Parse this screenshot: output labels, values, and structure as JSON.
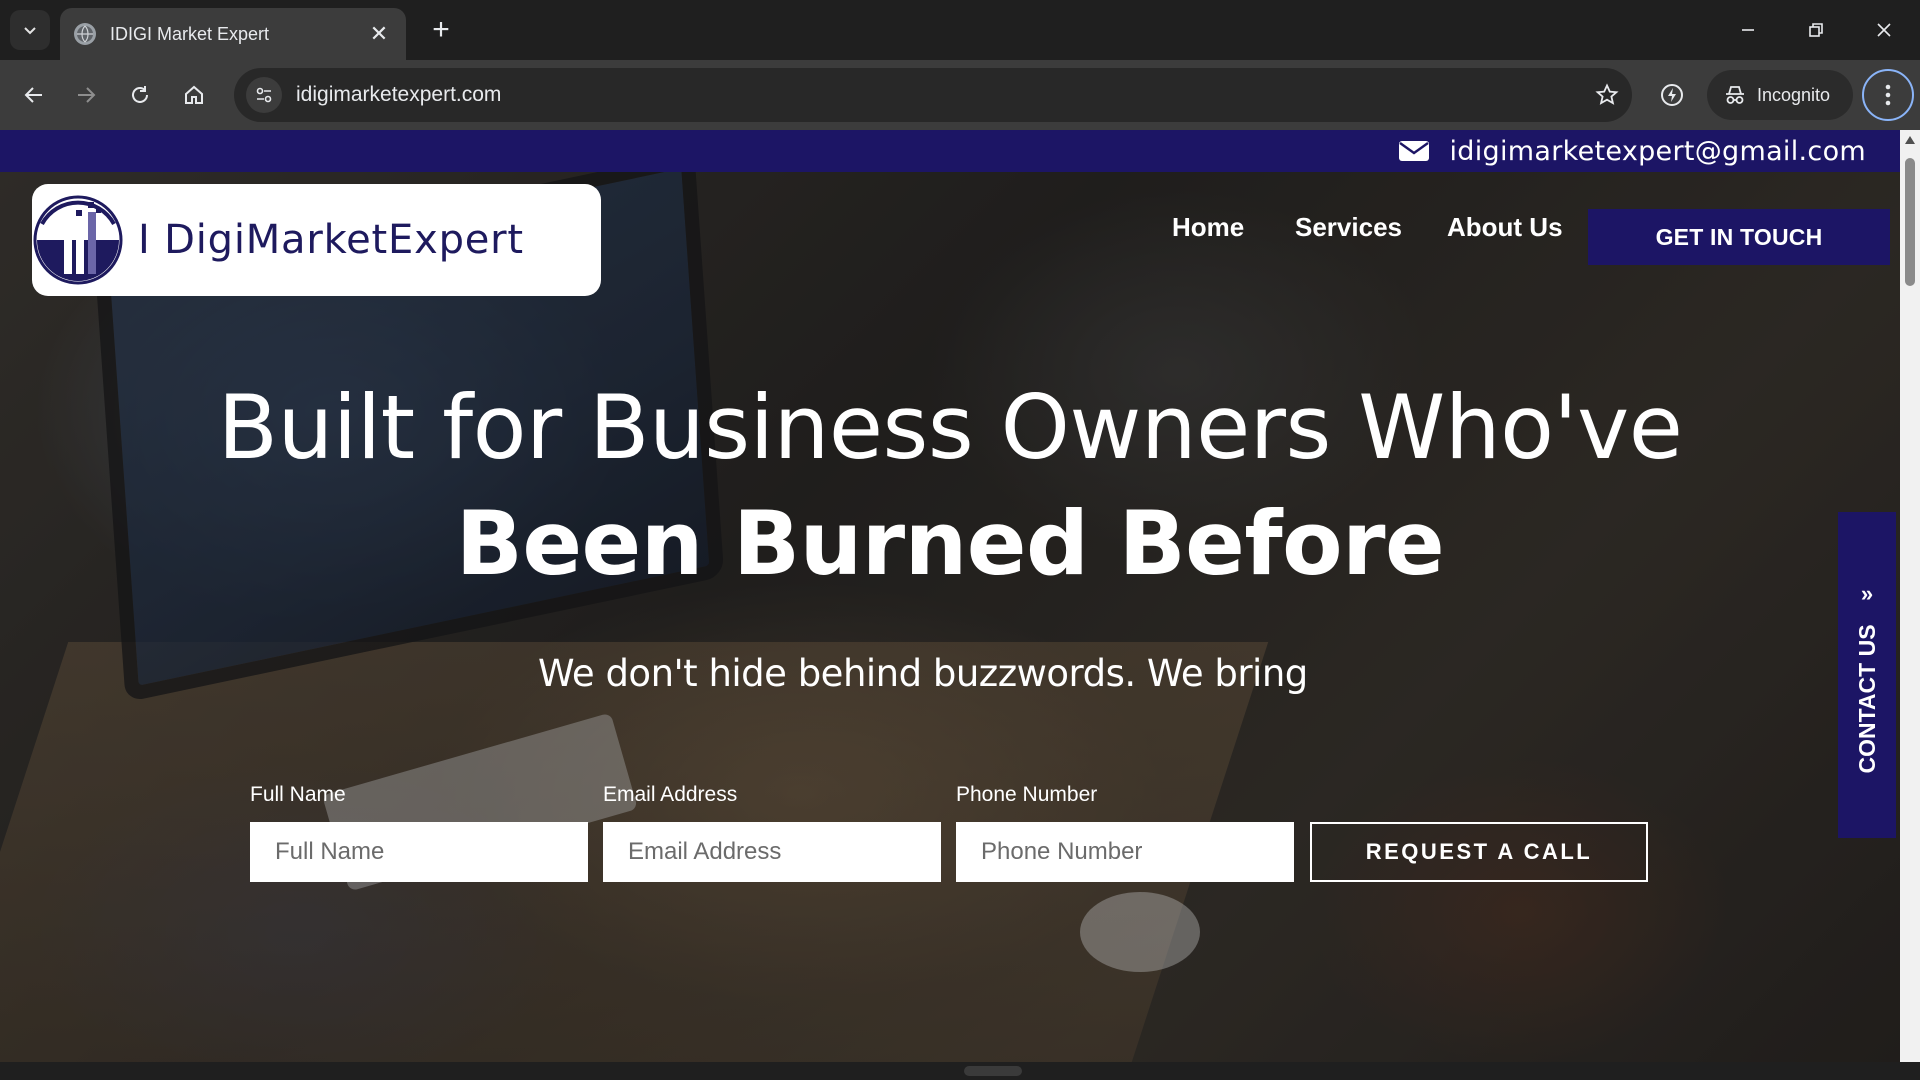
{
  "browser": {
    "tab_title": "IDIGI Market Expert",
    "url": "idigimarketexpert.com",
    "incognito_label": "Incognito"
  },
  "site": {
    "topbar_email": "idigimarketexpert@gmail.com",
    "brand_color": "#1c1565",
    "logo_text": "I DigiMarketExpert",
    "nav": {
      "home": "Home",
      "services": "Services",
      "about": "About Us",
      "cta": "GET IN TOUCH"
    },
    "hero": {
      "headline_line1": "Built for Business Owners Who've",
      "headline_line2": "Been Burned Before",
      "subhead": "We don't hide behind buzzwords. We bring"
    },
    "form": {
      "name_label": "Full Name",
      "name_placeholder": "Full Name",
      "email_label": "Email Address",
      "email_placeholder": "Email Address",
      "phone_label": "Phone Number",
      "phone_placeholder": "Phone Number",
      "submit": "REQUEST A CALL"
    },
    "contact_tab": "CONTACT US"
  }
}
